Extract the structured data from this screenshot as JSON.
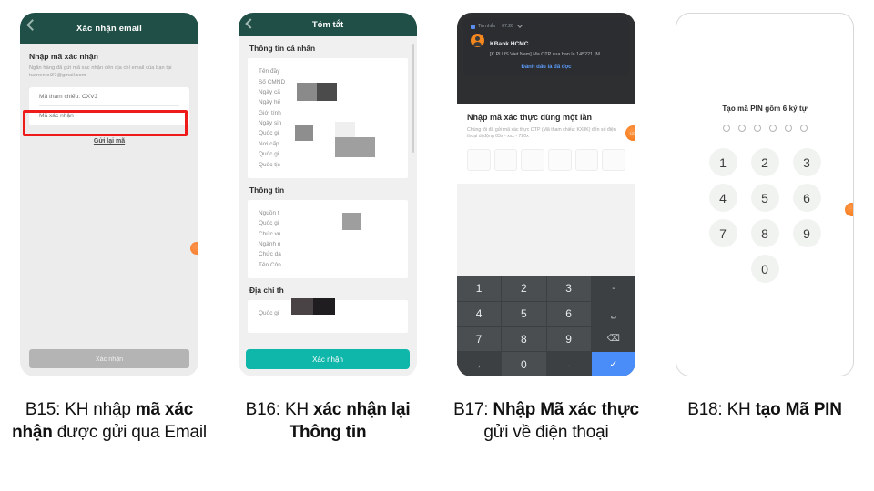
{
  "steps": [
    {
      "id": "b15",
      "caption_prefix": "B15: KH nhập ",
      "caption_bold": "mã xác nhận",
      "caption_suffix": " được gửi qua Email",
      "screen": {
        "header_title": "Xác nhận email",
        "section_title": "Nhập mã xác nhận",
        "subtitle": "Ngân hàng đã gửi mã xác nhận đến địa chỉ email của bạn tại tuanentoi37@gmail.com",
        "field_reference_label": "Mã tham chiếu: CXVJ",
        "field_code_placeholder": "Mã xác nhận",
        "resend_label": "Gửi lại mã",
        "cta_label": "Xác nhận",
        "highlight_color": "#ef1b1b",
        "header_color": "#1f4f46",
        "cta_color": "#b4b4b4"
      }
    },
    {
      "id": "b16",
      "caption_prefix": "B16: KH ",
      "caption_bold": "xác nhận lại Thông tin",
      "caption_suffix": "",
      "screen": {
        "header_title": "Tóm tắt",
        "sections": [
          {
            "title": "Thông tin cá nhân",
            "rows": [
              "Tên đầy",
              "Số CMND",
              "Ngày cấ",
              "Ngày hế",
              "Giới tính",
              "Ngày sin",
              "Quốc gi",
              "Nơi cấp",
              "Quốc gi",
              "Quốc tịc"
            ]
          },
          {
            "title": "Thông tin",
            "rows": [
              "Nguồn t",
              "Quốc gi",
              "Chức vụ",
              "Ngành n",
              "Chức da",
              "Tên Côn"
            ]
          },
          {
            "title": "Địa chỉ th",
            "rows": [
              "Quốc gi"
            ]
          }
        ],
        "cta_label": "Xác nhận",
        "header_color": "#1f4f46",
        "cta_color": "#0fb7aa"
      }
    },
    {
      "id": "b17",
      "caption_prefix": "B17: ",
      "caption_bold": "Nhập Mã xác thực",
      "caption_suffix": " gửi về điện thoại",
      "screen": {
        "notification": {
          "app_label": "Tin nhắn",
          "time": "07:26",
          "sender": "KBank HCMC",
          "preview": "[K PLUS Viet Nam] Ma OTP cua ban la 145221 (M...",
          "mark_read_label": "Đánh dấu là đã đọc"
        },
        "title": "Nhập mã xác thực dùng một lần",
        "description": "Chúng tôi đã gửi mã xác thực OTP (Mã tham chiếu: KX8K) đến số điện thoại di động 03x - xxx - 720x",
        "otp_cells": 6,
        "badge_label": "120s",
        "keypad": [
          [
            "1",
            "2",
            "3",
            "-"
          ],
          [
            "4",
            "5",
            "6",
            "␣"
          ],
          [
            "7",
            "8",
            "9",
            "⌫"
          ],
          [
            ",",
            "0",
            ".",
            "✓"
          ]
        ],
        "keypad_confirm_color": "#4b8df8"
      }
    },
    {
      "id": "b18",
      "caption_prefix": "B18: KH ",
      "caption_bold": "tạo Mã PIN",
      "caption_suffix": "",
      "screen": {
        "title": "Tạo mã PIN gồm 6 ký tự",
        "pin_length": 6,
        "keypad": [
          "1",
          "2",
          "3",
          "4",
          "5",
          "6",
          "7",
          "8",
          "9",
          "",
          "0",
          ""
        ]
      }
    }
  ]
}
